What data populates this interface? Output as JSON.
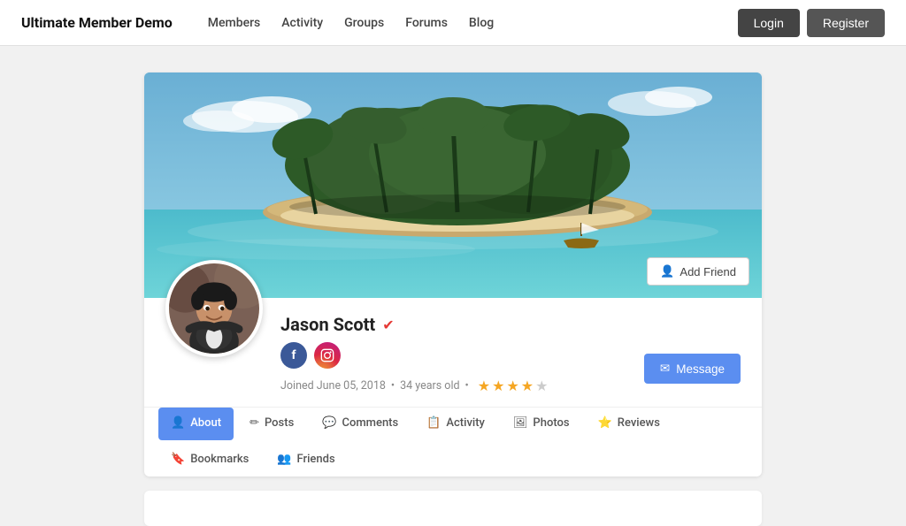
{
  "header": {
    "logo": "Ultimate Member Demo",
    "nav": [
      {
        "label": "Members",
        "href": "#"
      },
      {
        "label": "Activity",
        "href": "#"
      },
      {
        "label": "Groups",
        "href": "#"
      },
      {
        "label": "Forums",
        "href": "#"
      },
      {
        "label": "Blog",
        "href": "#"
      }
    ],
    "login_label": "Login",
    "register_label": "Register"
  },
  "profile": {
    "name": "Jason Scott",
    "verified": true,
    "joined": "Joined June 05, 2018",
    "age": "34 years old",
    "rating": 3.5,
    "rating_max": 5,
    "add_friend_label": "Add Friend",
    "message_label": "Message",
    "social": [
      {
        "name": "facebook",
        "label": "f"
      },
      {
        "name": "instagram",
        "label": "ig"
      }
    ]
  },
  "tabs": [
    {
      "label": "About",
      "icon": "user-icon",
      "active": true
    },
    {
      "label": "Posts",
      "icon": "pencil-icon",
      "active": false
    },
    {
      "label": "Comments",
      "icon": "comment-icon",
      "active": false
    },
    {
      "label": "Activity",
      "icon": "activity-icon",
      "active": false
    },
    {
      "label": "Photos",
      "icon": "photo-icon",
      "active": false
    },
    {
      "label": "Reviews",
      "icon": "star-icon",
      "active": false
    },
    {
      "label": "Bookmarks",
      "icon": "bookmark-icon",
      "active": false
    },
    {
      "label": "Friends",
      "icon": "friends-icon",
      "active": false
    }
  ]
}
